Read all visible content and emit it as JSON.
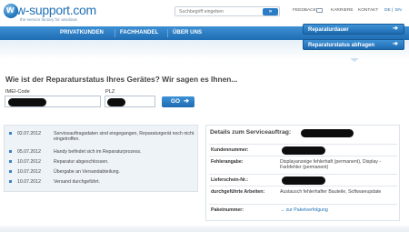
{
  "header": {
    "logo_text": "w-support.com",
    "logo_tagline": "the service factory for windows",
    "search_placeholder": "Suchbegriff eingeben",
    "search_button": "»",
    "links": [
      "FEEDBACK",
      "KARRIERE",
      "KONTAKT"
    ],
    "lang_de": "DE",
    "lang_sep": "|",
    "lang_en": "EN"
  },
  "nav": {
    "items": [
      "PRIVATKUNDEN",
      "FACHHANDEL",
      "ÜBER UNS"
    ]
  },
  "dropdown": {
    "items": [
      "Reparaturdauer",
      "Reparaturstatus abfragen"
    ]
  },
  "main": {
    "title": "Wie ist der Reparaturstatus Ihres Gerätes? Wir sagen es Ihnen...",
    "imei_label": "IMEI-Code",
    "plz_label": "PLZ",
    "go_button": "GO"
  },
  "status": [
    {
      "date": "02.07.2012",
      "text": "Serviceauftragsdaten sind eingegangen, Reparaturgerät noch nicht eingetroffen."
    },
    {
      "date": "05.07.2012",
      "text": "Handy befindet sich im Reparaturprozess."
    },
    {
      "date": "10.07.2012",
      "text": "Reparatur abgeschlossen."
    },
    {
      "date": "10.07.2012",
      "text": "Übergabe an Versandabteilung."
    },
    {
      "date": "10.07.2012",
      "text": "Versand durchgeführt."
    }
  ],
  "details": {
    "title": "Details zum Serviceauftrag:",
    "rows": [
      {
        "key": "Kundennummer:",
        "value": ""
      },
      {
        "key": "Fehlerangabe:",
        "value": "Displayanzeige fehlerhaft (permanent), Display - Farbfehler (permanent)"
      },
      {
        "key": "Lieferschein-Nr.:",
        "value": ""
      },
      {
        "key": "durchgeführte Arbeiten:",
        "value": "Austausch fehlerhafter Bauteile, Softwareupdate"
      },
      {
        "key": "Paketnummer:",
        "value": "→ zur Paketverfolgung"
      }
    ]
  }
}
